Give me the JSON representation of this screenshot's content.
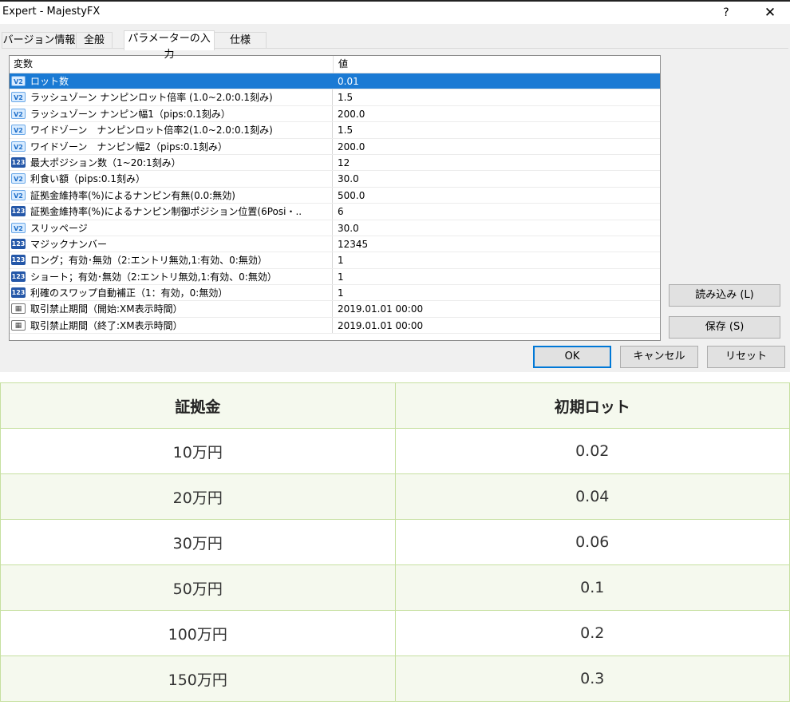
{
  "window": {
    "title": "Expert - MajestyFX",
    "help": "?",
    "close": "✕"
  },
  "tabs": [
    "バージョン情報",
    "全般",
    "パラメーターの入力",
    "仕様"
  ],
  "grid": {
    "headers": [
      "変数",
      "値"
    ],
    "rows": [
      {
        "icon": "V2",
        "name": "ロット数",
        "value": "0.01"
      },
      {
        "icon": "V2",
        "name": "ラッシュゾーン ナンピンロット倍率 (1.0~2.0:0.1刻み)",
        "value": "1.5"
      },
      {
        "icon": "V2",
        "name": "ラッシュゾーン ナンピン幅1（pips:0.1刻み）",
        "value": "200.0"
      },
      {
        "icon": "V2",
        "name": "ワイドゾーン　ナンピンロット倍率2(1.0~2.0:0.1刻み)",
        "value": "1.5"
      },
      {
        "icon": "V2",
        "name": "ワイドゾーン　ナンピン幅2（pips:0.1刻み）",
        "value": "200.0"
      },
      {
        "icon": "123",
        "name": "最大ポジション数（1~20:1刻み）",
        "value": "12"
      },
      {
        "icon": "V2",
        "name": "利食い額（pips:0.1刻み）",
        "value": "30.0"
      },
      {
        "icon": "V2",
        "name": "証拠金維持率(%)によるナンピン有無(0.0:無効)",
        "value": "500.0"
      },
      {
        "icon": "123",
        "name": "証拠金維持率(%)によるナンピン制御ポジション位置(6Posi・..",
        "value": "6"
      },
      {
        "icon": "V2",
        "name": "スリッページ",
        "value": "30.0"
      },
      {
        "icon": "123",
        "name": "マジックナンバー",
        "value": "12345"
      },
      {
        "icon": "123",
        "name": "ロング；有効･無効（2:エントリ無効,1:有効、0:無効）",
        "value": "1"
      },
      {
        "icon": "123",
        "name": "ショート；有効･無効（2:エントリ無効,1:有効、0:無効）",
        "value": "1"
      },
      {
        "icon": "123",
        "name": "利確のスワップ自動補正（1：有効，0:無効）",
        "value": "1"
      },
      {
        "icon": "cal",
        "name": "取引禁止期間（開始:XM表示時間）",
        "value": "2019.01.01 00:00"
      },
      {
        "icon": "cal",
        "name": "取引禁止期間（終了:XM表示時間）",
        "value": "2019.01.01 00:00"
      }
    ]
  },
  "buttons": {
    "load": "読み込み (L)",
    "save": "保存 (S)",
    "ok": "OK",
    "cancel": "キャンセル",
    "reset": "リセット"
  },
  "table": {
    "headers": [
      "証拠金",
      "初期ロット"
    ],
    "rows": [
      [
        "10万円",
        "0.02"
      ],
      [
        "20万円",
        "0.04"
      ],
      [
        "30万円",
        "0.06"
      ],
      [
        "50万円",
        "0.1"
      ],
      [
        "100万円",
        "0.2"
      ],
      [
        "150万円",
        "0.3"
      ]
    ]
  },
  "colors": {
    "selection": "#1a7ad4",
    "ok_border": "#0078d7",
    "table_border": "#c6e0a0",
    "table_stripe": "#f5f9ee"
  }
}
